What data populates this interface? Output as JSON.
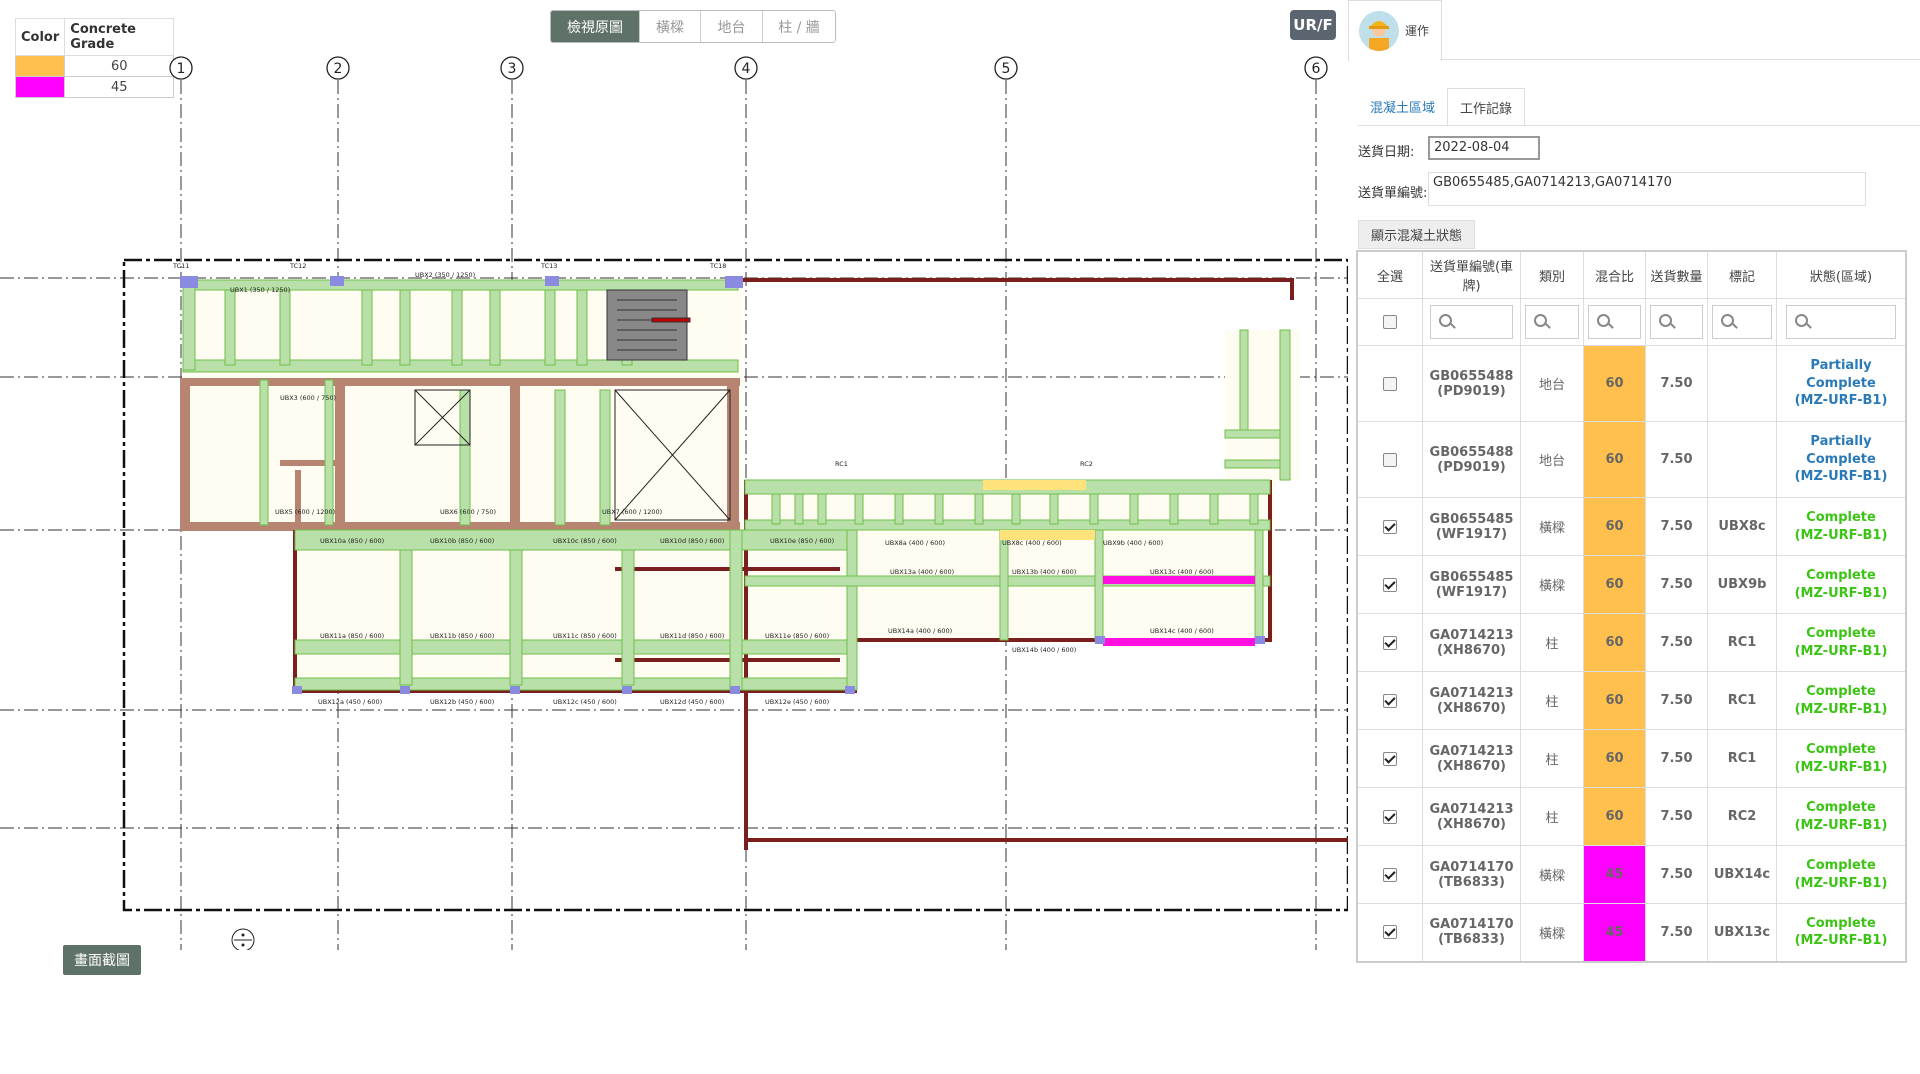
{
  "legend": {
    "headers": [
      "Color",
      "Concrete Grade"
    ],
    "rows": [
      {
        "color": "#ffc04d",
        "grade": "60"
      },
      {
        "color": "#ff00ff",
        "grade": "45"
      }
    ]
  },
  "view_tabs": [
    "檢視原圖",
    "橫樑",
    "地台",
    "柱 / 牆"
  ],
  "active_view_tab": 0,
  "floor_button": "UR/F",
  "screenshot_button": "畫面截圖",
  "grid_axes": [
    "1",
    "2",
    "3",
    "4",
    "5",
    "6"
  ],
  "plan_labels": {
    "beams": [
      "UBX1 (350 / 1250)",
      "UBX2 (350 / 1250)",
      "UBX3 (600 / 750)",
      "UBX5 (600 / 1200)",
      "UBX6 (600 / 750)",
      "UBX7 (600 / 1200)",
      "UBX10a (850 / 600)",
      "UBX10b (850 / 600)",
      "UBX10c (850 / 600)",
      "UBX10d (850 / 600)",
      "UBX10e (850 / 600)",
      "UBX11a (850 / 600)",
      "UBX11b (850 / 600)",
      "UBX11c (850 / 600)",
      "UBX11d (850 / 600)",
      "UBX11e (850 / 600)",
      "UBX12a (450 / 600)",
      "UBX12b (450 / 600)",
      "UBX12c (450 / 600)",
      "UBX12d (450 / 600)",
      "UBX12e (450 / 600)",
      "UBX13a (400 / 600)",
      "UBX13b (400 / 600)",
      "UBX13c (400 / 600)",
      "UBX14a (400 / 600)",
      "UBX14b (400 / 600)",
      "UBX14c (400 / 600)",
      "UBX8a (400 / 600)",
      "UBX8c (400 / 600)",
      "UBX9b (400 / 600)"
    ],
    "columns": [
      "TC11",
      "TC12",
      "TC13",
      "TC18",
      "RC1",
      "RC2"
    ]
  },
  "panel": {
    "user_name": "運作",
    "tabs": [
      "混凝土區域",
      "工作記錄"
    ],
    "active_tab": 1,
    "delivery_date_label": "送貨日期:",
    "delivery_date_value": "2022-08-04",
    "delivery_no_label": "送貨單編號:",
    "delivery_no_value": "GB0655485,GA0714213,GA0714170",
    "status_button": "顯示混凝土狀態",
    "table": {
      "headers": [
        "全選",
        "送貨單編號(車牌)",
        "類別",
        "混合比",
        "送貨數量",
        "標記",
        "狀態(區域)"
      ],
      "rows": [
        {
          "checked": false,
          "no": "GB0655488",
          "plate": "(PD9019)",
          "type": "地台",
          "mix": "60",
          "mix_color": "#ffc04d",
          "qty": "7.50",
          "mark": "",
          "status": "Partially Complete",
          "zone": "(MZ-URF-B1)",
          "state": "partial"
        },
        {
          "checked": false,
          "no": "GB0655488",
          "plate": "(PD9019)",
          "type": "地台",
          "mix": "60",
          "mix_color": "#ffc04d",
          "qty": "7.50",
          "mark": "",
          "status": "Partially Complete",
          "zone": "(MZ-URF-B1)",
          "state": "partial"
        },
        {
          "checked": true,
          "no": "GB0655485",
          "plate": "(WF1917)",
          "type": "橫樑",
          "mix": "60",
          "mix_color": "#ffc04d",
          "qty": "7.50",
          "mark": "UBX8c",
          "status": "Complete",
          "zone": "(MZ-URF-B1)",
          "state": "complete"
        },
        {
          "checked": true,
          "no": "GB0655485",
          "plate": "(WF1917)",
          "type": "橫樑",
          "mix": "60",
          "mix_color": "#ffc04d",
          "qty": "7.50",
          "mark": "UBX9b",
          "status": "Complete",
          "zone": "(MZ-URF-B1)",
          "state": "complete"
        },
        {
          "checked": true,
          "no": "GA0714213",
          "plate": "(XH8670)",
          "type": "柱",
          "mix": "60",
          "mix_color": "#ffc04d",
          "qty": "7.50",
          "mark": "RC1",
          "status": "Complete",
          "zone": "(MZ-URF-B1)",
          "state": "complete"
        },
        {
          "checked": true,
          "no": "GA0714213",
          "plate": "(XH8670)",
          "type": "柱",
          "mix": "60",
          "mix_color": "#ffc04d",
          "qty": "7.50",
          "mark": "RC1",
          "status": "Complete",
          "zone": "(MZ-URF-B1)",
          "state": "complete"
        },
        {
          "checked": true,
          "no": "GA0714213",
          "plate": "(XH8670)",
          "type": "柱",
          "mix": "60",
          "mix_color": "#ffc04d",
          "qty": "7.50",
          "mark": "RC1",
          "status": "Complete",
          "zone": "(MZ-URF-B1)",
          "state": "complete"
        },
        {
          "checked": true,
          "no": "GA0714213",
          "plate": "(XH8670)",
          "type": "柱",
          "mix": "60",
          "mix_color": "#ffc04d",
          "qty": "7.50",
          "mark": "RC2",
          "status": "Complete",
          "zone": "(MZ-URF-B1)",
          "state": "complete"
        },
        {
          "checked": true,
          "no": "GA0714170",
          "plate": "(TB6833)",
          "type": "橫樑",
          "mix": "45",
          "mix_color": "#ff00ff",
          "qty": "7.50",
          "mark": "UBX14c",
          "status": "Complete",
          "zone": "(MZ-URF-B1)",
          "state": "complete"
        },
        {
          "checked": true,
          "no": "GA0714170",
          "plate": "(TB6833)",
          "type": "橫樑",
          "mix": "45",
          "mix_color": "#ff00ff",
          "qty": "7.50",
          "mark": "UBX13c",
          "status": "Complete",
          "zone": "(MZ-URF-B1)",
          "state": "complete"
        }
      ]
    }
  }
}
